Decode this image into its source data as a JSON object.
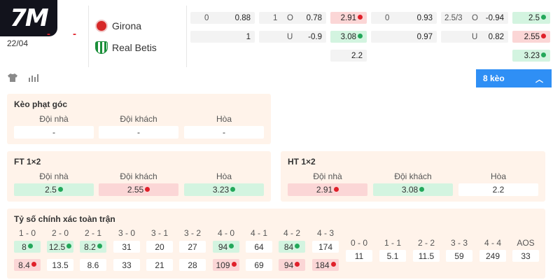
{
  "brand": {
    "logo_text": "7M",
    "logo_color": "#e0202a"
  },
  "match": {
    "date": "22/04",
    "score_home": "-",
    "score_away": "-",
    "home_team": "Girona",
    "away_team": "Real Betis",
    "home_icon": "girona-crest-icon",
    "away_icon": "real-betis-crest-icon"
  },
  "odds_ft": {
    "handicap": {
      "line_home": "0",
      "val_home": "0.88",
      "line_away": "1",
      "val_away": ""
    },
    "ou": {
      "line": "1",
      "o_label": "O",
      "o_val": "0.78",
      "u_label": "U",
      "u_val": "-0.9"
    },
    "x12": {
      "home": "2.91",
      "away": "3.08",
      "draw": "2.2"
    }
  },
  "odds_ht": {
    "handicap": {
      "line": "0",
      "home": "0.93",
      "away": "0.97"
    },
    "ou": {
      "line": "2.5/3",
      "o_label": "O",
      "o_val": "-0.94",
      "u_label": "U",
      "u_val": "0.82"
    },
    "x12": {
      "home": "2.5",
      "away": "2.55",
      "draw": "3.23"
    }
  },
  "toolbar": {
    "kit_icon": "shirt-icon",
    "stats_icon": "bar-chart-icon",
    "keo_label": "8 kèo"
  },
  "corner": {
    "title": "Kèo phạt góc",
    "headers": [
      "Đội nhà",
      "Đội khách",
      "Hòa"
    ],
    "values": [
      "-",
      "-",
      "-"
    ]
  },
  "ft12": {
    "title": "FT 1×2",
    "headers": [
      "Đội nhà",
      "Đội khách",
      "Hòa"
    ],
    "values": [
      "2.5",
      "2.55",
      "3.23"
    ]
  },
  "ht12": {
    "title": "HT 1×2",
    "headers": [
      "Đội nhà",
      "Đội khách",
      "Hòa"
    ],
    "values": [
      "2.91",
      "3.08",
      "2.2"
    ]
  },
  "correct_score": {
    "title": "Tỷ số chính xác toàn trận",
    "home_win": {
      "headers": [
        "1 - 0",
        "2 - 0",
        "2 - 1",
        "3 - 0",
        "3 - 1",
        "3 - 2",
        "4 - 0",
        "4 - 1",
        "4 - 2",
        "4 - 3"
      ],
      "row1": [
        "8",
        "12.5",
        "8.2",
        "31",
        "20",
        "27",
        "94",
        "64",
        "84",
        "174"
      ],
      "row2": [
        "8.4",
        "13.5",
        "8.6",
        "33",
        "21",
        "28",
        "109",
        "69",
        "94",
        "184"
      ]
    },
    "draw": {
      "headers": [
        "0 - 0",
        "1 - 1",
        "2 - 2",
        "3 - 3",
        "4 - 4",
        "AOS"
      ],
      "row": [
        "11",
        "5.1",
        "11.5",
        "59",
        "249",
        "33"
      ]
    }
  },
  "colors": {
    "up": "#23a85a",
    "down": "#e0202a",
    "accent": "#2f8ff5",
    "panel": "#fff3ea"
  }
}
